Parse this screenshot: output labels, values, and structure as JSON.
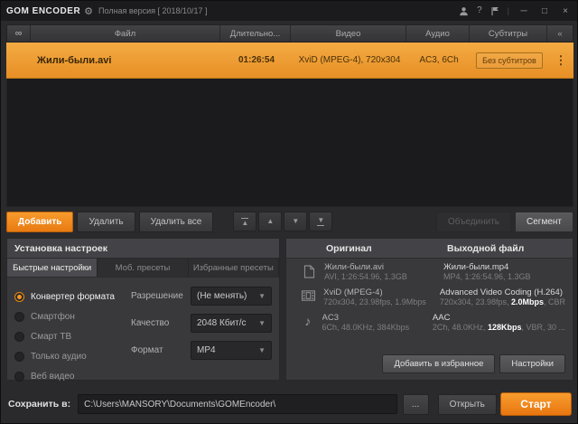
{
  "title_bar": {
    "app_name": "GOM ENCODER",
    "version_text": "Полная версия  [ 2018/10/17 ]",
    "minimize": "─",
    "maximize": "□",
    "close": "×",
    "help": "?"
  },
  "file_table": {
    "columns": [
      "Файл",
      "Длительно...",
      "Видео",
      "Аудио",
      "Субтитры",
      "«"
    ],
    "rows": [
      {
        "file": "Жили-были.avi",
        "duration": "01:26:54",
        "video": "XviD (MPEG-4), 720x304",
        "audio": "AC3, 6Ch",
        "subtitles": "Без субтитров",
        "menu": "⋮"
      }
    ]
  },
  "toolbar": {
    "add": "Добавить",
    "remove": "Удалить",
    "remove_all": "Удалить все",
    "merge": "Объединить",
    "segment": "Сегмент",
    "move_up": "▲",
    "move_down": "▼"
  },
  "settings_panel": {
    "title": "Установка настроек",
    "tabs": [
      {
        "label": "Быстрые настройки"
      },
      {
        "label": "Моб. пресеты"
      },
      {
        "label": "Избранные пресеты"
      }
    ],
    "radios": [
      {
        "label": "Конвертер формата"
      },
      {
        "label": "Смартфон"
      },
      {
        "label": "Смарт ТВ"
      },
      {
        "label": "Только аудио"
      },
      {
        "label": "Веб видео"
      }
    ],
    "fields": [
      {
        "label": "Разрешение",
        "value": "(Не менять)"
      },
      {
        "label": "Качество",
        "value": "2048 Кбит/с"
      },
      {
        "label": "Формат",
        "value": "MP4"
      }
    ]
  },
  "info_panel": {
    "original_title": "Оригинал",
    "output_title": "Выходной файл",
    "rows": [
      {
        "orig_line1": "Жили-были.avi",
        "orig_line2": "AVI, 1:26:54.96, 1.3GB",
        "out_line1": "Жили-были.mp4",
        "out_line2_plain": "MP4, 1:26:54.96, 1.3GB",
        "out_line2_strong": "",
        "out_line2_tail": ""
      },
      {
        "orig_line1": "XviD (MPEG-4)",
        "orig_line2": "720x304, 23.98fps, 1.9Mbps",
        "out_line1": "Advanced Video Coding (H.264)",
        "out_line2_plain": "720x304, 23.98fps, ",
        "out_line2_strong": "2.0Mbps",
        "out_line2_tail": ", CBR"
      },
      {
        "orig_line1": "AC3",
        "orig_line2": "6Ch, 48.0KHz, 384Kbps",
        "out_line1": "AAC",
        "out_line2_plain": "2Ch, 48.0KHz, ",
        "out_line2_strong": "128Kbps",
        "out_line2_tail": ", VBR, 30 ..."
      }
    ],
    "favorite_button": "Добавить в избранное",
    "settings_button": "Настройки"
  },
  "bottom_bar": {
    "save_label": "Сохранить в:",
    "path": "C:\\Users\\MANSORY\\Documents\\GOMEncoder\\",
    "browse": "...",
    "open": "Открыть",
    "start": "Старт"
  },
  "colors": {
    "accent_orange": "#ef7e18",
    "row_selected": "#f0a03a",
    "background": "#2a2a2c"
  }
}
